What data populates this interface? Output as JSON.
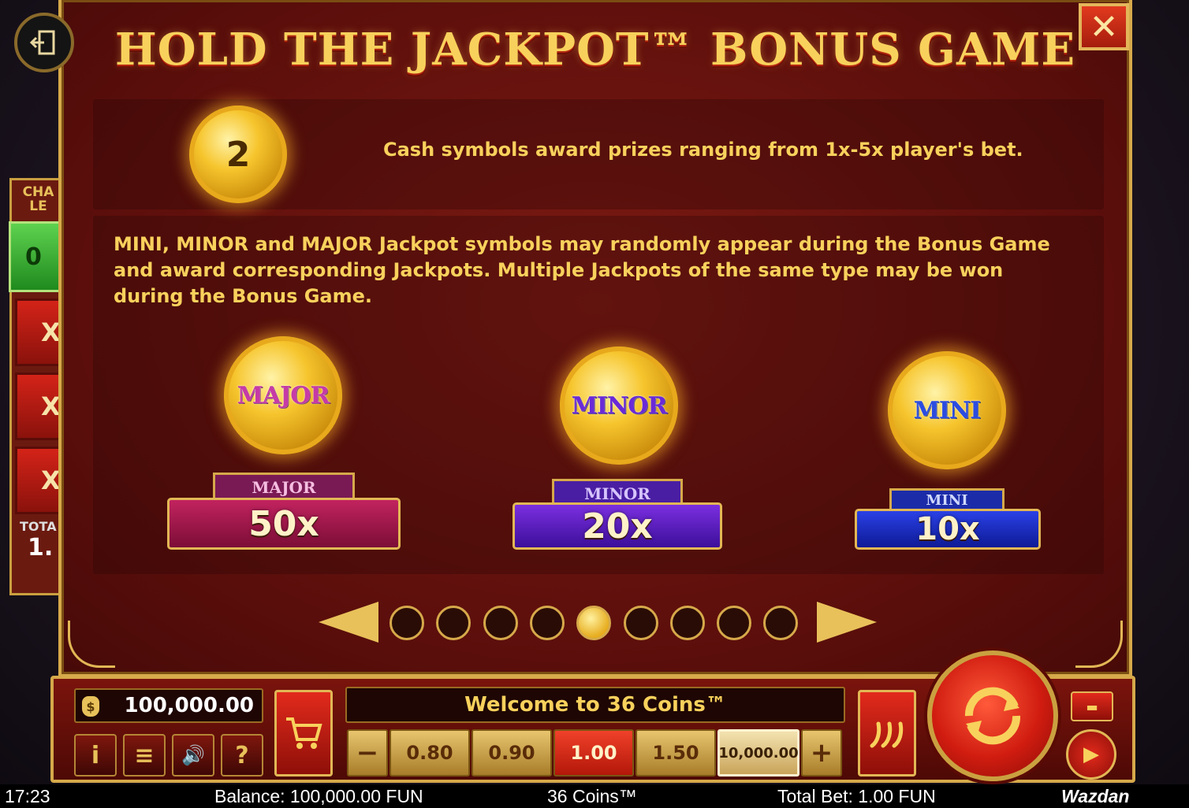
{
  "modal": {
    "title": "HOLD THE JACKPOT™ BONUS GAME",
    "close_label": "✕",
    "cash_coin_value": "2",
    "cash_text": "Cash symbols award prizes ranging from 1x-5x player's bet.",
    "jackpot_text": "MINI, MINOR and MAJOR Jackpot symbols may randomly appear during the Bonus Game and award corresponding Jackpots. Multiple Jackpots of the same type may be won during the Bonus Game.",
    "jackpots": [
      {
        "coin_label": "MAJOR",
        "tag": "MAJOR",
        "value": "50x",
        "color": "#c2235f"
      },
      {
        "coin_label": "MINOR",
        "tag": "MINOR",
        "value": "20x",
        "color": "#7b2fe0"
      },
      {
        "coin_label": "MINI",
        "tag": "MINI",
        "value": "10x",
        "color": "#2a41e6"
      }
    ],
    "pager": {
      "total_pages": 9,
      "current_page": 5
    }
  },
  "side_panel": {
    "label": "CHA LE",
    "green_value": "0",
    "multipliers": [
      "X",
      "X",
      "X'"
    ],
    "total_label": "TOTA",
    "total_value": "1."
  },
  "controls": {
    "balance": "100,000.00",
    "welcome": "Welcome to 36 Coins™",
    "bets": [
      "0.80",
      "0.90",
      "1.00",
      "1.50"
    ],
    "selected_bet": "1.00",
    "max_bet": "10,000.00",
    "minus_label": "−",
    "plus_label": "+",
    "info_icon": "i",
    "menu_icon": "≡",
    "sound_icon": "🔊",
    "help_icon": "?"
  },
  "status_bar": {
    "time": "17:23",
    "balance": "Balance: 100,000.00 FUN",
    "game_name": "36 Coins™",
    "total_bet": "Total Bet: 1.00 FUN",
    "brand": "Wazdan"
  },
  "colors": {
    "gold": "#f8d15c",
    "modal_red": "#7d1a13",
    "major": "#c2235f",
    "minor": "#7b2fe0",
    "mini": "#2a41e6"
  }
}
